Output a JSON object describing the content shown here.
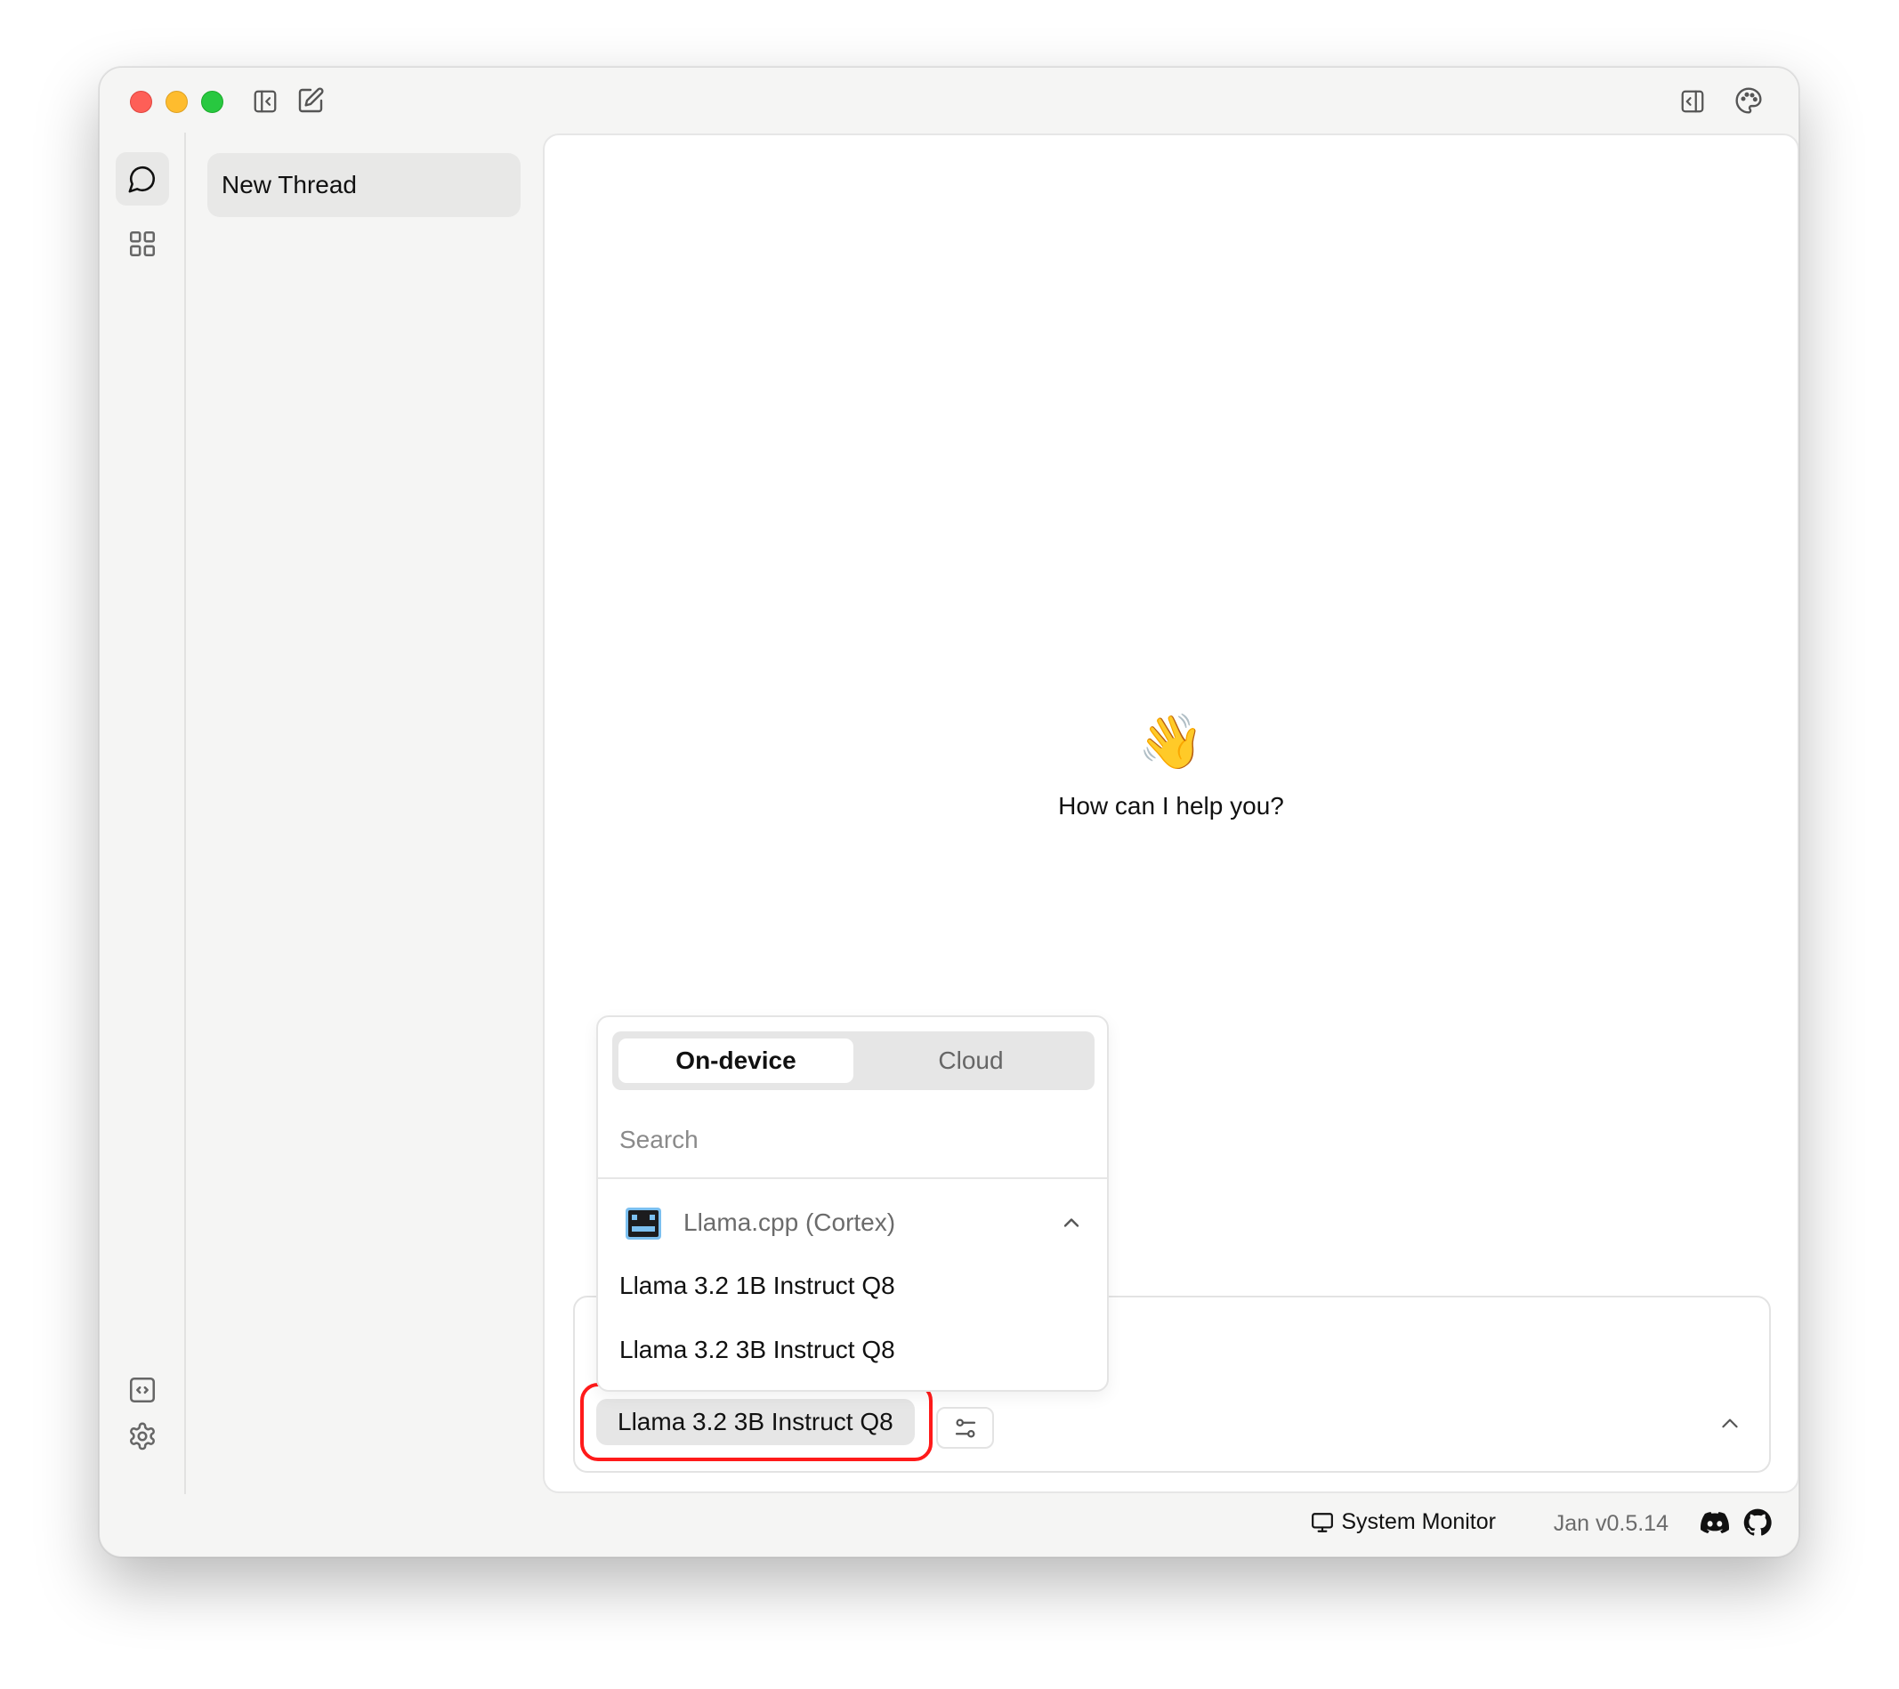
{
  "window": {
    "traffic_lights": [
      "close",
      "minimize",
      "maximize"
    ],
    "toolbar_left_icons": [
      "sidebar-collapse-icon",
      "new-thread-edit-icon"
    ],
    "toolbar_right_icons": [
      "right-panel-toggle-icon",
      "palette-icon"
    ]
  },
  "rail": {
    "items": [
      {
        "icon": "chat-bubble-icon",
        "label": "Threads",
        "active": true
      },
      {
        "icon": "grid-icon",
        "label": "Hub",
        "active": false
      }
    ],
    "bottom_items": [
      {
        "icon": "code-icon",
        "label": "Local API Server"
      },
      {
        "icon": "gear-icon",
        "label": "Settings"
      }
    ]
  },
  "threads": {
    "items": [
      {
        "title": "New Thread",
        "active": true
      }
    ]
  },
  "main": {
    "welcome_emoji": "👋",
    "welcome_text": "How can I help you?"
  },
  "model_dropdown": {
    "tabs": [
      {
        "label": "On-device",
        "active": true
      },
      {
        "label": "Cloud",
        "active": false
      }
    ],
    "search_placeholder": "Search",
    "search_value": "",
    "providers": [
      {
        "name": "Llama.cpp (Cortex)",
        "icon": "llamacpp-logo-icon",
        "expanded": true,
        "models": [
          "Llama 3.2 1B Instruct Q8",
          "Llama 3.2 3B Instruct Q8"
        ]
      }
    ]
  },
  "composer": {
    "selected_model": "Llama 3.2 3B Instruct Q8",
    "settings_icon": "sliders-icon",
    "expand_icon": "chevron-up-icon"
  },
  "status_bar": {
    "system_monitor_label": "System Monitor",
    "version": "Jan v0.5.14",
    "links": [
      "discord-icon",
      "github-icon"
    ]
  },
  "colors": {
    "highlight_ring": "#ff1a1a",
    "window_bg": "#f5f5f4",
    "panel_bg": "#ffffff",
    "pill_bg": "#e6e6e6",
    "llamacpp_logo_blue": "#7cc0f0"
  }
}
